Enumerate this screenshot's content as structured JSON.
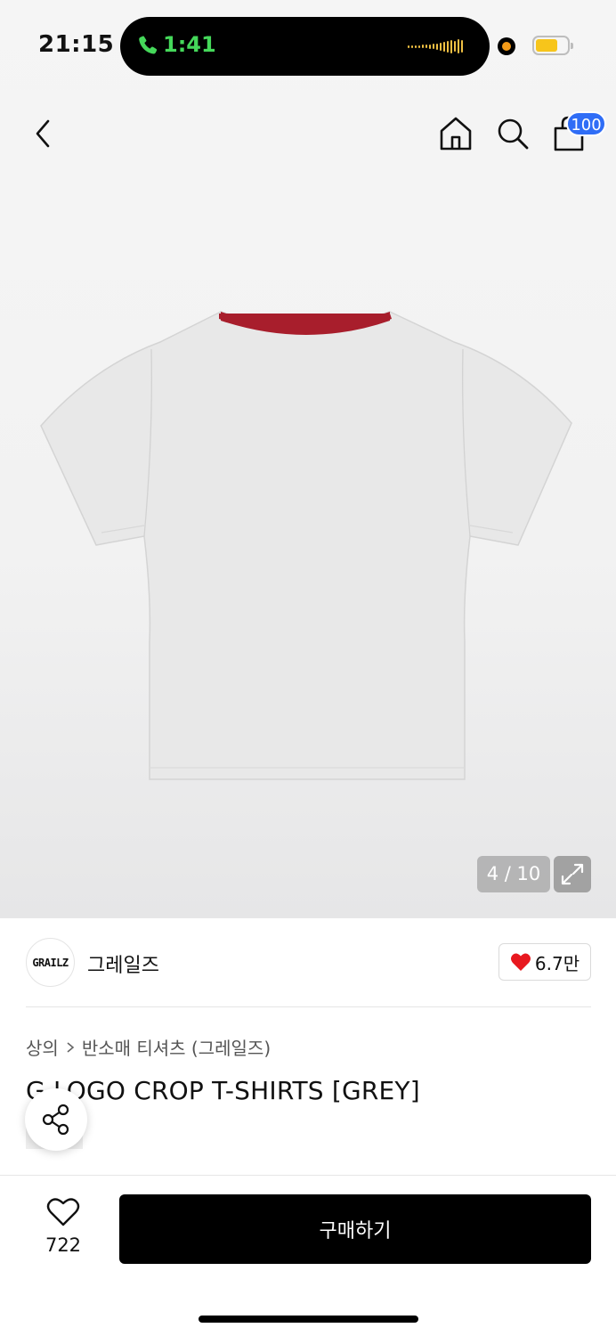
{
  "status_bar": {
    "time": "21:15",
    "call_time": "1:41",
    "accent_call": "#45d85a",
    "battery_color": "#f7c51b"
  },
  "nav": {
    "cart_count": "100",
    "icons": [
      "back-icon",
      "home-icon",
      "search-icon",
      "bag-icon"
    ]
  },
  "gallery": {
    "counter": "4 / 10",
    "current": 4,
    "total": 10
  },
  "brand": {
    "logo_text": "GRAILZ",
    "name": "그레일즈",
    "likes": "6.7만"
  },
  "breadcrumb": {
    "category": "상의",
    "subcategory": "반소매 티셔츠 (그레일즈)"
  },
  "product": {
    "title": "G LOGO CROP T-SHIRTS [GREY]"
  },
  "bottom_bar": {
    "wishlist_count": "722",
    "buy_label": "구매하기"
  },
  "colors": {
    "badge": "#2f6df6",
    "heart": "#e8181f",
    "collar": "#a81e2c",
    "shirt": "#e8e8e8"
  }
}
